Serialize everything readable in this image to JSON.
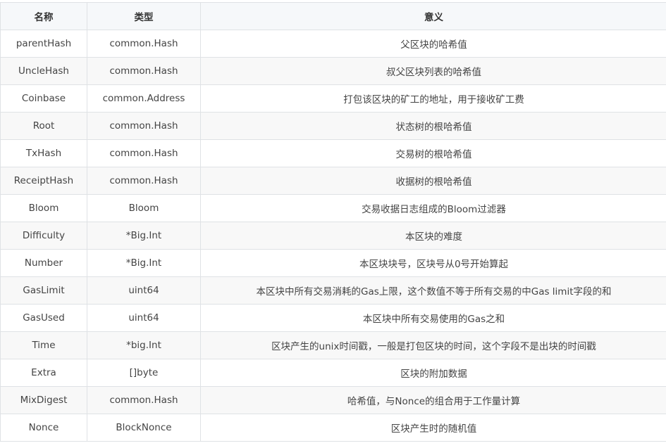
{
  "table": {
    "headers": [
      "名称",
      "类型",
      "意义"
    ],
    "rows": [
      [
        "parentHash",
        "common.Hash",
        "父区块的哈希值"
      ],
      [
        "UncleHash",
        "common.Hash",
        "叔父区块列表的哈希值"
      ],
      [
        "Coinbase",
        "common.Address",
        "打包该区块的矿工的地址，用于接收矿工费"
      ],
      [
        "Root",
        "common.Hash",
        "状态树的根哈希值"
      ],
      [
        "TxHash",
        "common.Hash",
        "交易树的根哈希值"
      ],
      [
        "ReceiptHash",
        "common.Hash",
        "收据树的根哈希值"
      ],
      [
        "Bloom",
        "Bloom",
        "交易收据日志组成的Bloom过滤器"
      ],
      [
        "Difficulty",
        "*Big.Int",
        "本区块的难度"
      ],
      [
        "Number",
        "*Big.Int",
        "本区块块号，区块号从0号开始算起"
      ],
      [
        "GasLimit",
        "uint64",
        "本区块中所有交易消耗的Gas上限，这个数值不等于所有交易的中Gas limit字段的和"
      ],
      [
        "GasUsed",
        "uint64",
        "本区块中所有交易使用的Gas之和"
      ],
      [
        "Time",
        "*big.Int",
        "区块产生的unix时间戳，一般是打包区块的时间，这个字段不是出块的时间戳"
      ],
      [
        "Extra",
        "[]byte",
        "区块的附加数据"
      ],
      [
        "MixDigest",
        "common.Hash",
        "哈希值，与Nonce的组合用于工作量计算"
      ],
      [
        "Nonce",
        "BlockNonce",
        "区块产生时的随机值"
      ]
    ]
  }
}
